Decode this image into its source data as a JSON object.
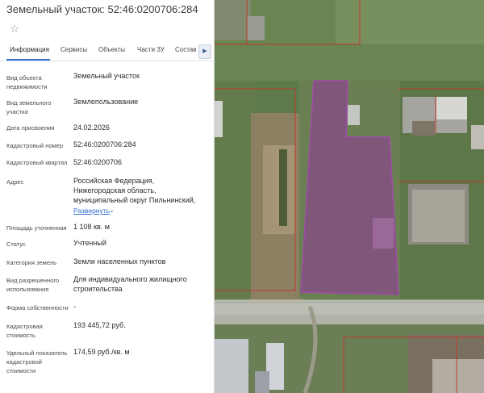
{
  "card": {
    "title": "Земельный участок: 52:46:0200706:284",
    "favorite_icon": "star-outline-icon"
  },
  "tabs": [
    {
      "label": "Информация",
      "active": true
    },
    {
      "label": "Сервисы",
      "active": false
    },
    {
      "label": "Объекты",
      "active": false
    },
    {
      "label": "Части ЗУ",
      "active": false
    },
    {
      "label": "Состав",
      "active": false
    }
  ],
  "tabs_next_icon": "chevron-right-icon",
  "fields": {
    "object_type": {
      "label": "Вид объекта недвижимости",
      "value": "Земельный участок"
    },
    "land_type": {
      "label": "Вид земельного участка",
      "value": "Землепользование"
    },
    "assign_date": {
      "label": "Дата присвоения",
      "value": "24.02.2026"
    },
    "cadastral_number": {
      "label": "Кадастровый номер",
      "value": "52:46:0200706:284"
    },
    "cadastral_quarter": {
      "label": "Кадастровый квартал",
      "value": "52:46:0200706"
    },
    "address": {
      "label": "Адрес",
      "value": "Российская Федерация, Нижегородская область, муниципальный округ Пильнинский,"
    },
    "expand": {
      "label": "Развернуть"
    },
    "area": {
      "label": "Площадь уточненная",
      "value": "1 108 кв. м"
    },
    "status": {
      "label": "Статус",
      "value": "Учтенный"
    },
    "land_category": {
      "label": "Категория земель",
      "value": "Земли населенных пунктов"
    },
    "permitted_use": {
      "label": "Вид разрешенного использования",
      "value": "Для индивидуального жилищного строительства"
    },
    "ownership_form": {
      "label": "Форма собственности",
      "value": "-"
    },
    "cadastral_value": {
      "label": "Кадастровая стоимость",
      "value": "193 445,72 руб."
    },
    "specific_value": {
      "label": "Удельный показатель кадастровой стоимости",
      "value": "174,59 руб./кв. м"
    }
  },
  "map": {
    "parcel_fill": "#8e3d95",
    "boundary_color": "#c0392b"
  }
}
